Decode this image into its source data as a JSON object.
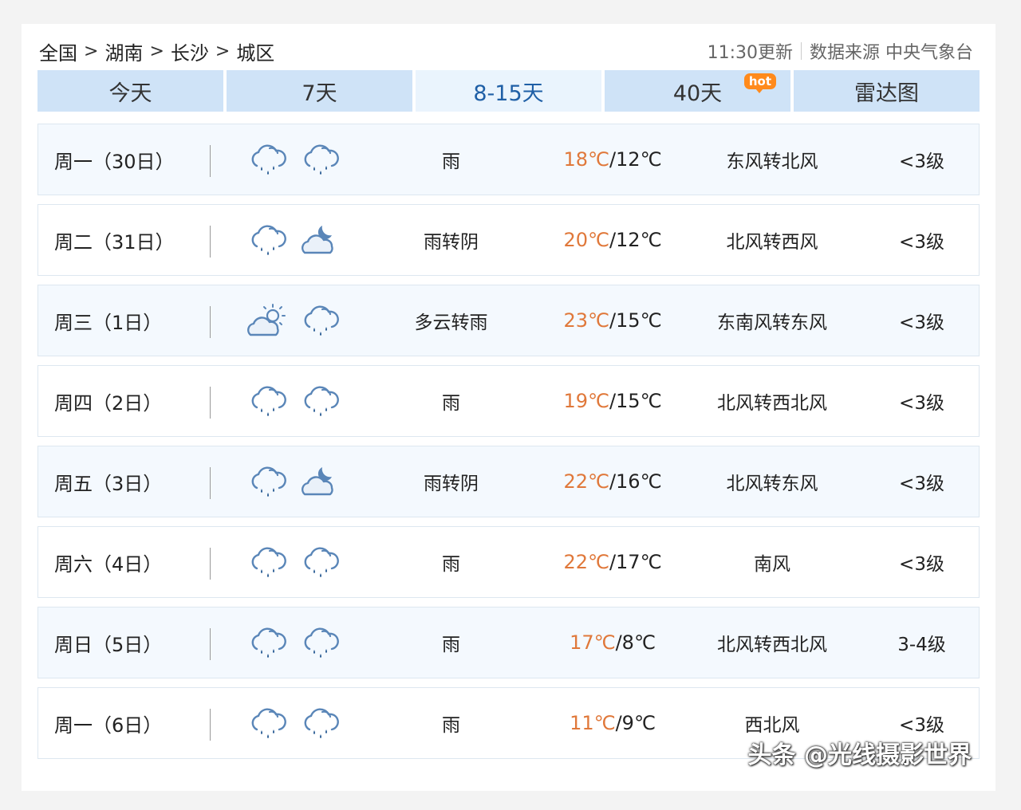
{
  "breadcrumb": [
    "全国",
    "湖南",
    "长沙",
    "城区"
  ],
  "breadcrumb_sep": ">",
  "update_time": "11:30更新",
  "source": "数据来源 中央气象台",
  "tabs": [
    {
      "label": "今天"
    },
    {
      "label": "7天"
    },
    {
      "label": "8-15天",
      "active": true
    },
    {
      "label": "40天",
      "badge": "hot"
    },
    {
      "label": "雷达图"
    }
  ],
  "days": [
    {
      "day": "周一（30日）",
      "icons": [
        "rain-cloud-icon",
        "rain-cloud-icon"
      ],
      "desc": "雨",
      "high": "18℃",
      "low": "/12℃",
      "wind": "东风转北风",
      "level": "<3级"
    },
    {
      "day": "周二（31日）",
      "icons": [
        "rain-cloud-icon",
        "cloudy-night-icon"
      ],
      "desc": "雨转阴",
      "high": "20℃",
      "low": "/12℃",
      "wind": "北风转西风",
      "level": "<3级"
    },
    {
      "day": "周三（1日）",
      "icons": [
        "partly-cloudy-sun-icon",
        "rain-cloud-icon"
      ],
      "desc": "多云转雨",
      "high": "23℃",
      "low": "/15℃",
      "wind": "东南风转东风",
      "level": "<3级"
    },
    {
      "day": "周四（2日）",
      "icons": [
        "rain-cloud-icon",
        "rain-cloud-icon"
      ],
      "desc": "雨",
      "high": "19℃",
      "low": "/15℃",
      "wind": "北风转西北风",
      "level": "<3级"
    },
    {
      "day": "周五（3日）",
      "icons": [
        "rain-cloud-icon",
        "cloudy-night-icon"
      ],
      "desc": "雨转阴",
      "high": "22℃",
      "low": "/16℃",
      "wind": "北风转东风",
      "level": "<3级"
    },
    {
      "day": "周六（4日）",
      "icons": [
        "rain-cloud-icon",
        "rain-cloud-icon"
      ],
      "desc": "雨",
      "high": "22℃",
      "low": "/17℃",
      "wind": "南风",
      "level": "<3级"
    },
    {
      "day": "周日（5日）",
      "icons": [
        "rain-cloud-icon",
        "rain-cloud-icon"
      ],
      "desc": "雨",
      "high": "17℃",
      "low": "/8℃",
      "wind": "北风转西北风",
      "level": "3-4级"
    },
    {
      "day": "周一（6日）",
      "icons": [
        "rain-cloud-icon",
        "rain-cloud-icon"
      ],
      "desc": "雨",
      "high": "11℃",
      "low": "/9℃",
      "wind": "西北风",
      "level": "<3级"
    }
  ],
  "colors": {
    "accent": "#1f5fa6",
    "high_temp": "#e0783a",
    "tab_bg": "#cfe3f7",
    "hot_badge": "#ff8a1c"
  },
  "watermark": "头条 @光线摄影世界"
}
